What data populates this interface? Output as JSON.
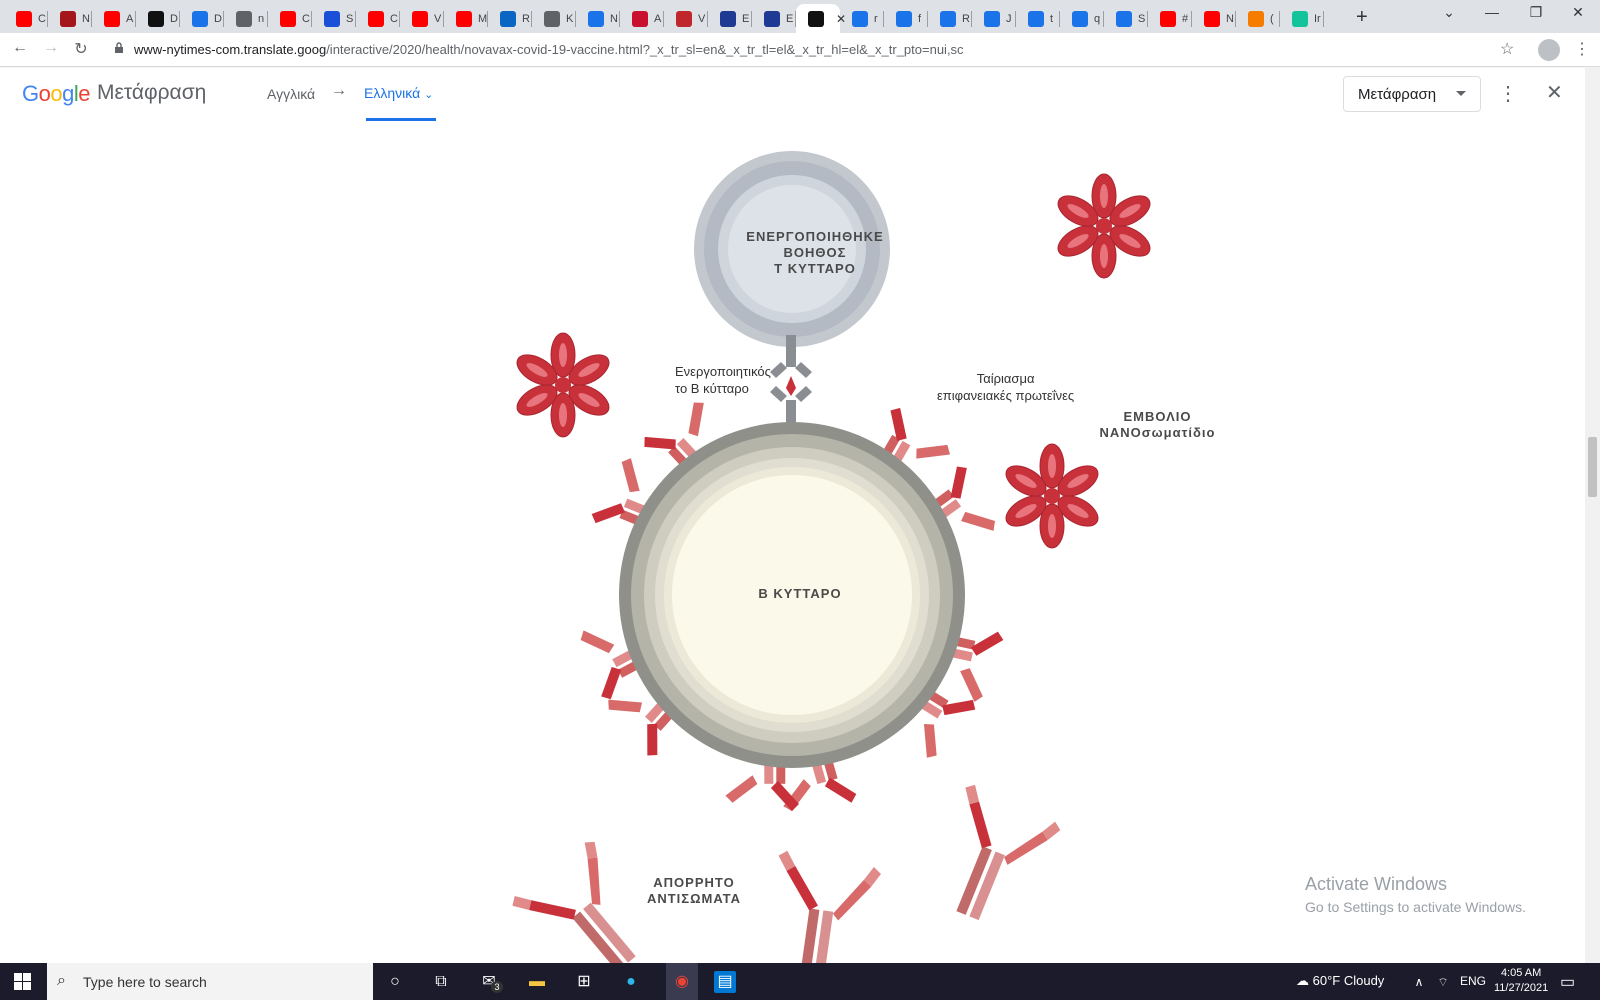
{
  "browser": {
    "tabs": [
      {
        "icon": "youtube-icon",
        "letter": "C",
        "color": "#ff0000"
      },
      {
        "icon": "letter-a-icon",
        "letter": "N",
        "color": "#a4161a"
      },
      {
        "icon": "youtube-icon",
        "letter": "A",
        "color": "#ff0000"
      },
      {
        "icon": "s-logo-icon",
        "letter": "D",
        "color": "#111111"
      },
      {
        "icon": "download-icon",
        "letter": "D",
        "color": "#1a73e8"
      },
      {
        "icon": "globe-icon",
        "letter": "n",
        "color": "#5f6368"
      },
      {
        "icon": "youtube-icon",
        "letter": "C",
        "color": "#ff0000"
      },
      {
        "icon": "play-icon",
        "letter": "S",
        "color": "#1a4fd8"
      },
      {
        "icon": "youtube-icon",
        "letter": "C",
        "color": "#ff0000"
      },
      {
        "icon": "youtube-icon",
        "letter": "V",
        "color": "#ff0000"
      },
      {
        "icon": "youtube-icon",
        "letter": "M",
        "color": "#ff0000"
      },
      {
        "icon": "linkedin-icon",
        "letter": "R",
        "color": "#0a66c2"
      },
      {
        "icon": "globe-icon",
        "letter": "K",
        "color": "#5f6368"
      },
      {
        "icon": "translate-icon",
        "letter": "N",
        "color": "#1a73e8"
      },
      {
        "icon": "heart-icon",
        "letter": "A",
        "color": "#c8102e"
      },
      {
        "icon": "wb-icon",
        "letter": "V",
        "color": "#c0272d"
      },
      {
        "icon": "mr-icon",
        "letter": "E",
        "color": "#1f3a93"
      },
      {
        "icon": "mr-icon",
        "letter": "E",
        "color": "#1f3a93"
      },
      {
        "icon": "nyt-icon",
        "letter": "",
        "color": "#111111",
        "active": true
      },
      {
        "icon": "p-icon",
        "letter": "r",
        "color": "#1a73e8"
      },
      {
        "icon": "p-icon",
        "letter": "f",
        "color": "#1a73e8"
      },
      {
        "icon": "p-icon",
        "letter": "R",
        "color": "#1a73e8"
      },
      {
        "icon": "p-icon",
        "letter": "J",
        "color": "#1a73e8"
      },
      {
        "icon": "p-icon",
        "letter": "t",
        "color": "#1a73e8"
      },
      {
        "icon": "p-icon",
        "letter": "q",
        "color": "#1a73e8"
      },
      {
        "icon": "p-icon",
        "letter": "S",
        "color": "#1a73e8"
      },
      {
        "icon": "youtube-icon",
        "letter": "#",
        "color": "#ff0000"
      },
      {
        "icon": "youtube-icon",
        "letter": "N",
        "color": "#ff0000"
      },
      {
        "icon": "ph-icon",
        "letter": "(",
        "color": "#f57c00"
      },
      {
        "icon": "grammarly-icon",
        "letter": "Ir",
        "color": "#15c39a"
      }
    ],
    "url_host": "www-nytimes-com.translate.goog",
    "url_path": "/interactive/2020/health/novavax-covid-19-vaccine.html?_x_tr_sl=en&_x_tr_tl=el&_x_tr_hl=el&_x_tr_pto=nui,sc"
  },
  "translate_bar": {
    "logo": [
      "G",
      "o",
      "o",
      "g",
      "l",
      "e"
    ],
    "title": "Μετάφραση",
    "source_lang": "Αγγλικά",
    "arrow": "→",
    "target_lang": "Ελληνικά",
    "translate_button": "Μετάφραση"
  },
  "diagram": {
    "t_cell_label_1": "ΕΝΕΡΓΟΠΟΙΗΘΗΚΕ",
    "t_cell_label_2": "ΒΟΗΘΟΣ",
    "t_cell_label_3": "Τ ΚΥΤΤΑΡΟ",
    "activates_1": "Ενεργοποιητικός",
    "activates_2": "το Β κύτταρο",
    "matching_1": "Ταίριασμα",
    "matching_2": "επιφανειακές πρωτεΐνες",
    "nanoparticle_1": "ΕΜΒΟΛΙΟ",
    "nanoparticle_2": "ΝΑΝΟσωματίδιο",
    "b_cell_label": "Β ΚΥΤΤΑΡΟ",
    "antibodies_1": "ΑΠΟΡΡΗΤΟ",
    "antibodies_2": "ΑΝΤΙΣΩΜΑΤΑ",
    "colors": {
      "spike": "#c8303a",
      "antibody": "#d06060",
      "b_cell_fill": "#fbf9e9",
      "t_cell_fill": "#d5dae0"
    }
  },
  "watermark": {
    "line1": "Activate Windows",
    "line2": "Go to Settings to activate Windows."
  },
  "taskbar": {
    "search_placeholder": "Type here to search",
    "mail_badge": "3",
    "weather": "60°F  Cloudy",
    "lang": "ENG",
    "time": "4:05 AM",
    "date": "11/27/2021"
  }
}
